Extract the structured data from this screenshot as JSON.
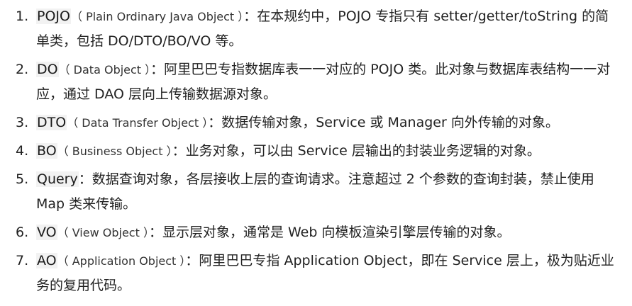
{
  "items": [
    {
      "number": "1.",
      "term": "POJO",
      "paren": "（ Plain Ordinary Java Object ）",
      "desc": "：在本规约中，POJO 专指只有 setter/getter/toString 的简单类，包括 DO/DTO/BO/VO 等。"
    },
    {
      "number": "2.",
      "term": "DO",
      "paren": "（ Data Object ）",
      "desc": "：阿里巴巴专指数据库表一一对应的 POJO 类。此对象与数据库表结构一一对应，通过 DAO 层向上传输数据源对象。"
    },
    {
      "number": "3.",
      "term": "DTO",
      "paren": "（ Data Transfer Object ）",
      "desc": "：数据传输对象，Service 或 Manager 向外传输的对象。"
    },
    {
      "number": "4.",
      "term": "BO",
      "paren": "（ Business Object ）",
      "desc": "：业务对象，可以由 Service 层输出的封装业务逻辑的对象。"
    },
    {
      "number": "5.",
      "term": "Query",
      "paren": "",
      "desc": "：数据查询对象，各层接收上层的查询请求。注意超过 2 个参数的查询封装，禁止使用 Map 类来传输。"
    },
    {
      "number": "6.",
      "term": "VO",
      "paren": "（ View Object ）",
      "desc": "：显示层对象，通常是 Web 向模板渲染引擎层传输的对象。"
    },
    {
      "number": "7.",
      "term": "AO",
      "paren": "（ Application Object ）",
      "desc": "：阿里巴巴专指 Application Object，即在 Service 层上，极为贴近业务的复用代码。"
    }
  ]
}
